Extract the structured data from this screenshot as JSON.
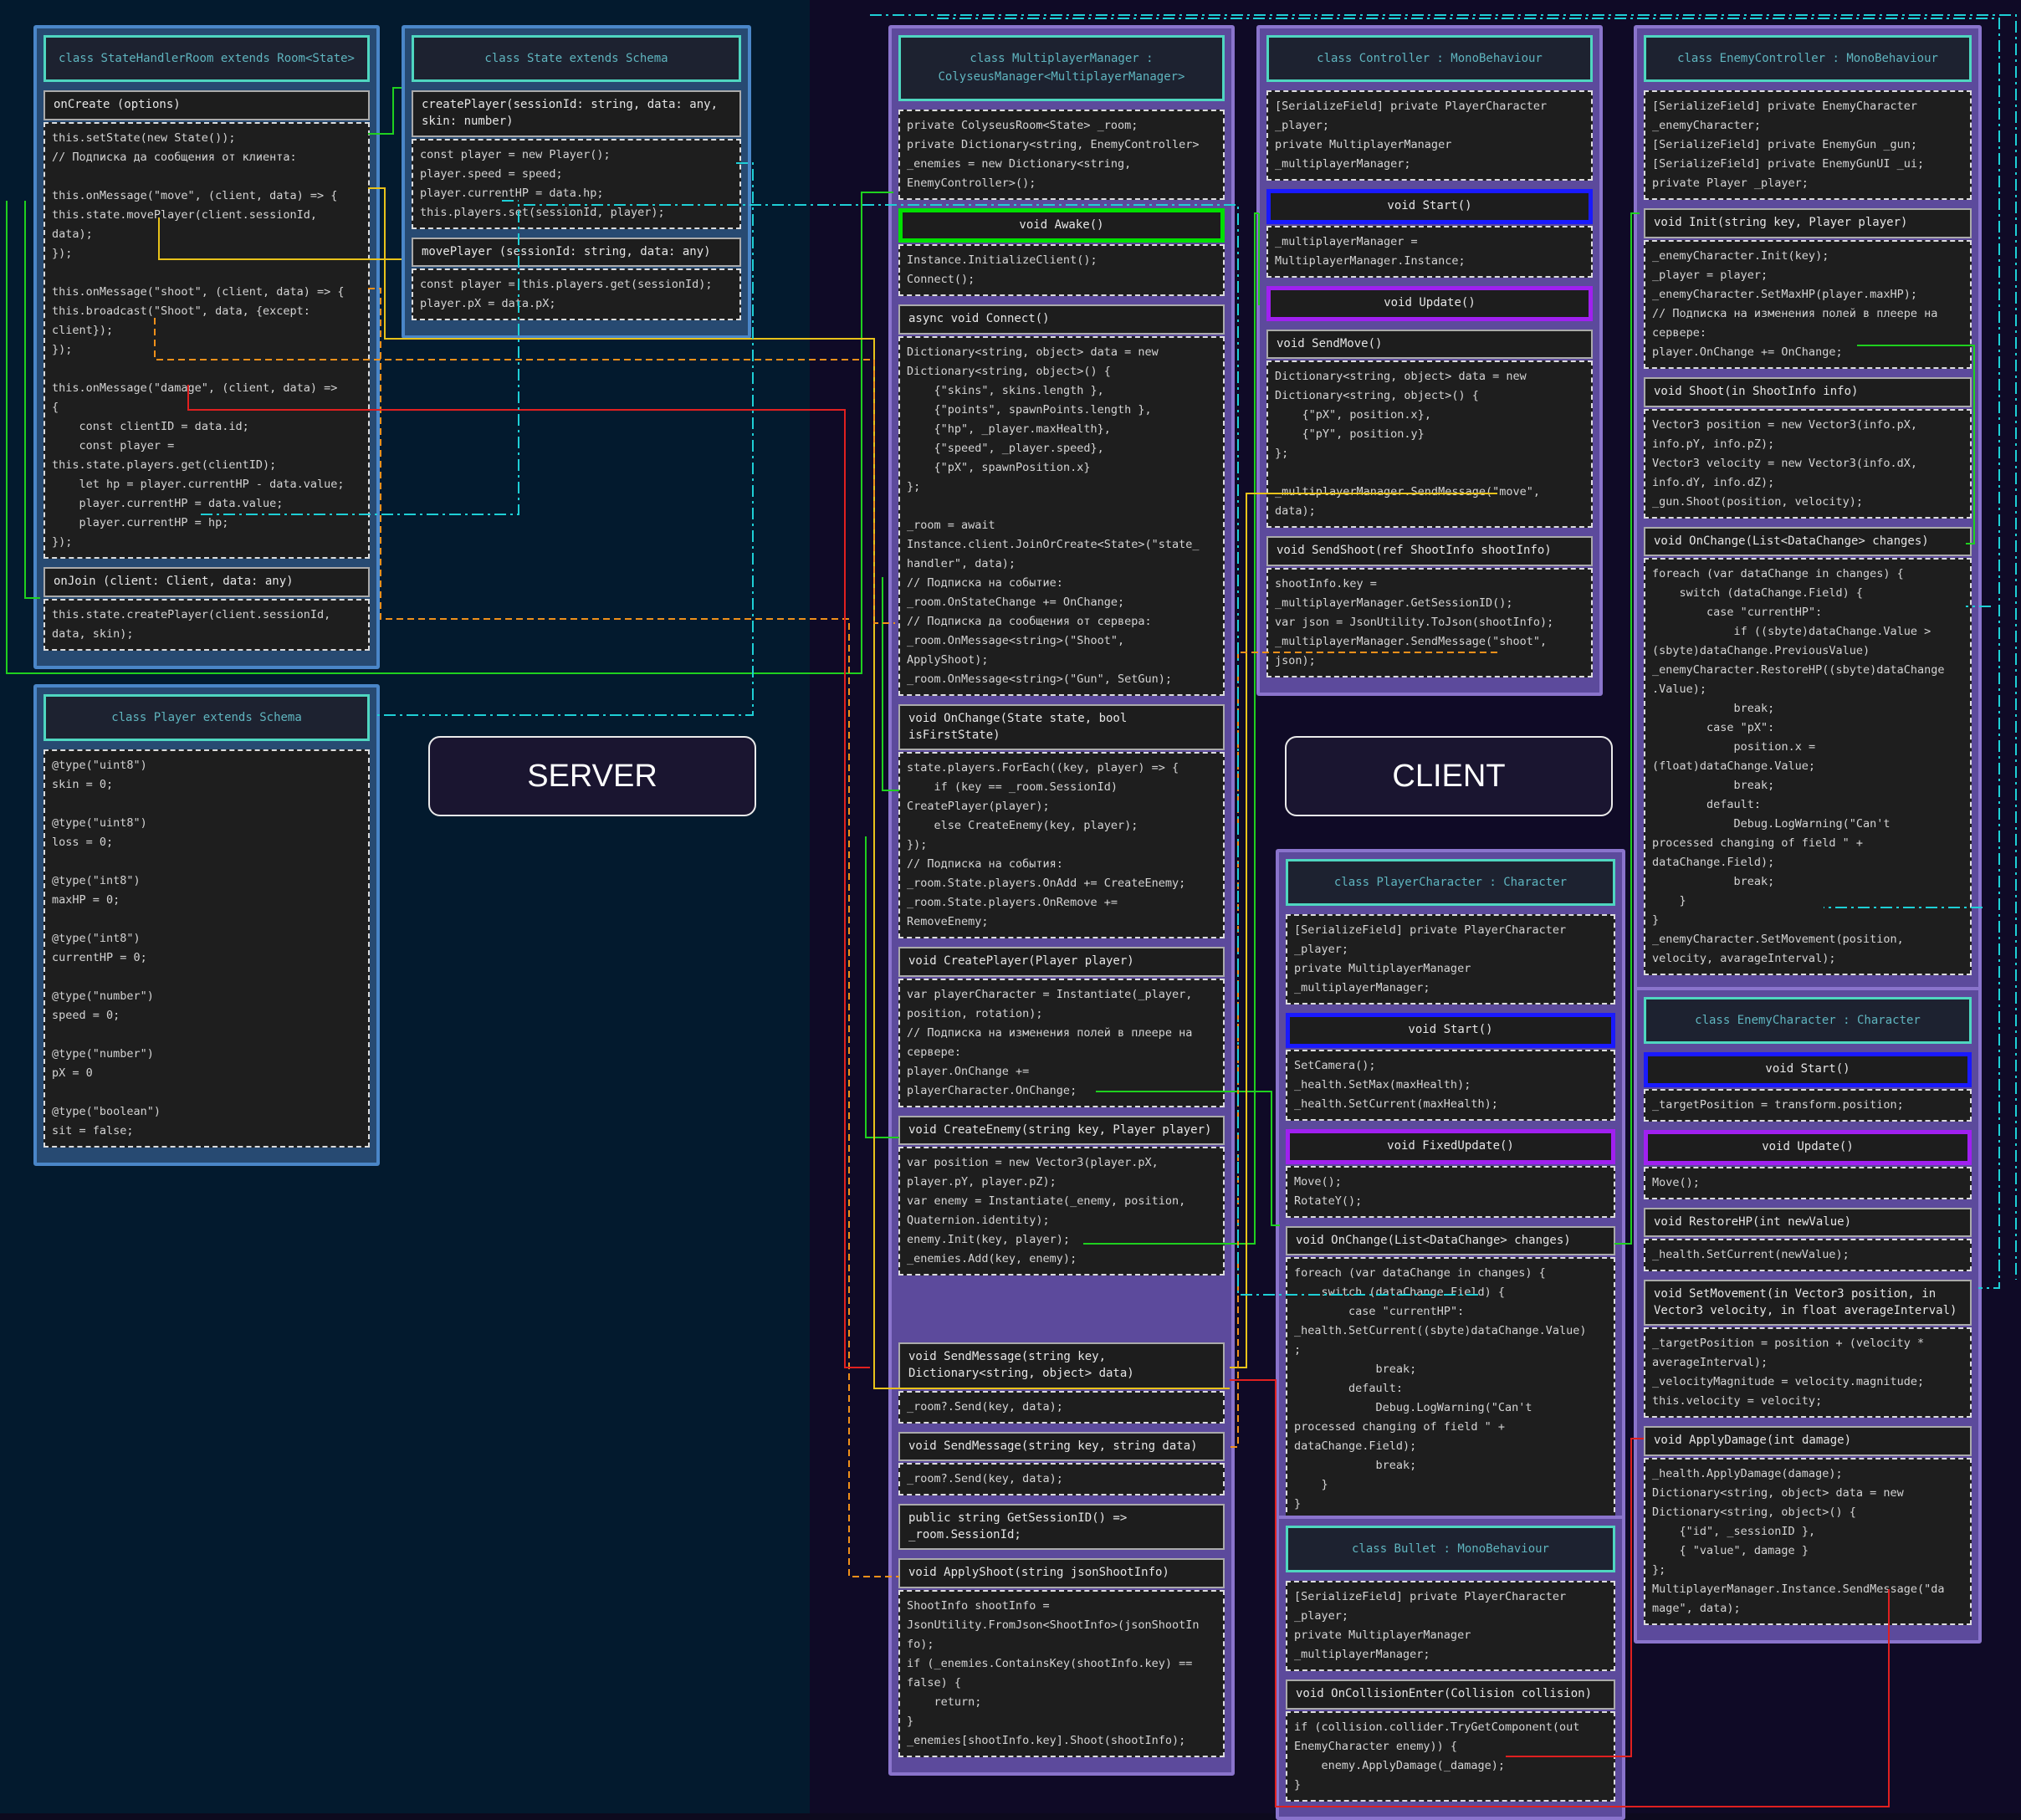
{
  "labels": {
    "server": "SERVER",
    "client": "CLIENT"
  },
  "colors": {
    "server_bg": "#031a2e",
    "client_bg": "#0f0a26",
    "class_head_border": "#4fd6c0",
    "awake_border": "#00e000",
    "start_border": "#1a1aff",
    "update_border": "#a020f0"
  },
  "classes": [
    {
      "id": "state-handler-room",
      "side": "srv",
      "title": "class StateHandlerRoom extends Room<State>",
      "sections": [
        {
          "h": "onCreate (options)",
          "b": "this.setState(new State());\n// Подписка да сообщения от клиента:\n\nthis.onMessage(\"move\", (client, data) => {\nthis.state.movePlayer(client.sessionId,\ndata);\n});\n\nthis.onMessage(\"shoot\", (client, data) => {\nthis.broadcast(\"Shoot\", data, {except:\nclient});\n});\n\nthis.onMessage(\"damage\", (client, data) =>\n{\n    const clientID = data.id;\n    const player =\nthis.state.players.get(clientID);\n    let hp = player.currentHP - data.value;\n    player.currentHP = data.value;\n    player.currentHP = hp;\n});"
        },
        {
          "h": "onJoin (client: Client, data: any)",
          "b": "this.state.createPlayer(client.sessionId,\ndata, skin);"
        }
      ]
    },
    {
      "id": "state-schema",
      "side": "srv",
      "title": "class State extends Schema",
      "sections": [
        {
          "h": "createPlayer(sessionId: string, data: any,\nskin: number)",
          "b": "const player = new Player();\nplayer.speed = speed;\nplayer.currentHP = data.hp;\nthis.players.set(sessionId, player);"
        },
        {
          "h": "movePlayer (sessionId: string, data: any)",
          "b": "const player = this.players.get(sessionId);\nplayer.pX = data.pX;"
        }
      ]
    },
    {
      "id": "player-schema",
      "side": "srv",
      "title": "class Player extends Schema",
      "sections": [
        {
          "b": "@type(\"uint8\")\nskin = 0;\n\n@type(\"uint8\")\nloss = 0;\n\n@type(\"int8\")\nmaxHP = 0;\n\n@type(\"int8\")\ncurrentHP = 0;\n\n@type(\"number\")\nspeed = 0;\n\n@type(\"number\")\npX = 0\n\n@type(\"boolean\")\nsit = false;"
        }
      ]
    },
    {
      "id": "multiplayer-manager",
      "side": "cli",
      "title": "class MultiplayerManager :\nColyseusManager<MultiplayerManager>",
      "sections": [
        {
          "b": "private ColyseusRoom<State> _room;\nprivate Dictionary<string, EnemyController>\n_enemies = new Dictionary<string,\nEnemyController>();"
        },
        {
          "h": "void Awake()",
          "k": "green",
          "b": "Instance.InitializeClient();\nConnect();"
        },
        {
          "h": "async void Connect()",
          "b": "Dictionary<string, object> data = new\nDictionary<string, object>() {\n    {\"skins\", skins.length },\n    {\"points\", spawnPoints.length },\n    {\"hp\", _player.maxHealth},\n    {\"speed\", _player.speed},\n    {\"pX\", spawnPosition.x}\n};\n\n_room = await\nInstance.client.JoinOrCreate<State>(\"state_\nhandler\", data);\n// Подписка на событие:\n_room.OnStateChange += OnChange;\n// Подписка да сообщения от сервера:\n_room.OnMessage<string>(\"Shoot\",\nApplyShoot);\n_room.OnMessage<string>(\"Gun\", SetGun);"
        },
        {
          "h": "void OnChange(State state, bool\nisFirstState)",
          "b": "state.players.ForEach((key, player) => {\n    if (key == _room.SessionId)\nCreatePlayer(player);\n    else CreateEnemy(key, player);\n});\n// Подписка на события:\n_room.State.players.OnAdd += CreateEnemy;\n_room.State.players.OnRemove +=\nRemoveEnemy;"
        },
        {
          "h": "void CreatePlayer(Player player)",
          "b": "var playerCharacter = Instantiate(_player,\nposition, rotation);\n// Подписка на изменения полей в плеере на\nсервере:\nplayer.OnChange +=\nplayerCharacter.OnChange;"
        },
        {
          "h": "void CreateEnemy(string key, Player player)",
          "b": "var position = new Vector3(player.pX,\nplayer.pY, player.pZ);\nvar enemy = Instantiate(_enemy, position,\nQuaternion.identity);\nenemy.Init(key, player);\n_enemies.Add(key, enemy);"
        },
        {
          "gap": 70
        },
        {
          "h": "void SendMessage(string key,\nDictionary<string, object> data)",
          "b": "_room?.Send(key, data);"
        },
        {
          "h": "void SendMessage(string key, string data)",
          "b": "_room?.Send(key, data);"
        },
        {
          "h": "public string GetSessionID() =>\n_room.SessionId;"
        },
        {
          "h": "void ApplyShoot(string jsonShootInfo)",
          "b": "ShootInfo shootInfo =\nJsonUtility.FromJson<ShootInfo>(jsonShootIn\nfo);\nif (_enemies.ContainsKey(shootInfo.key) ==\nfalse) {\n    return;\n}\n_enemies[shootInfo.key].Shoot(shootInfo);"
        }
      ]
    },
    {
      "id": "controller",
      "side": "cli",
      "title": "class Controller : MonoBehaviour",
      "sections": [
        {
          "b": "[SerializeField] private PlayerCharacter\n_player;\nprivate MultiplayerManager\n_multiplayerManager;"
        },
        {
          "h": "void Start()",
          "k": "blue",
          "b": "_multiplayerManager =\nMultiplayerManager.Instance;"
        },
        {
          "h": "void Update()",
          "k": "purple"
        },
        {
          "h": "void SendMove()",
          "b": "Dictionary<string, object> data = new\nDictionary<string, object>() {\n    {\"pX\", position.x},\n    {\"pY\", position.y}\n};\n\n_multiplayerManager.SendMessage(\"move\",\ndata);"
        },
        {
          "h": "void SendShoot(ref ShootInfo shootInfo)",
          "b": "shootInfo.key =\n_multiplayerManager.GetSessionID();\nvar json = JsonUtility.ToJson(shootInfo);\n_multiplayerManager.SendMessage(\"shoot\",\njson);"
        }
      ]
    },
    {
      "id": "player-character",
      "side": "cli",
      "title": "class PlayerCharacter : Character",
      "sections": [
        {
          "b": "[SerializeField] private PlayerCharacter\n_player;\nprivate MultiplayerManager\n_multiplayerManager;"
        },
        {
          "h": "void Start()",
          "k": "blue",
          "b": "SetCamera();\n_health.SetMax(maxHealth);\n_health.SetCurrent(maxHealth);"
        },
        {
          "h": "void FixedUpdate()",
          "k": "purple",
          "b": "Move();\nRotateY();"
        },
        {
          "h": "void OnChange(List<DataChange> changes)",
          "b": "foreach (var dataChange in changes) {\n    switch (dataChange.Field) {\n        case \"currentHP\":\n_health.SetCurrent((sbyte)dataChange.Value)\n;\n            break;\n        default:\n            Debug.LogWarning(\"Can't\nprocessed changing of field \" +\ndataChange.Field);\n            break;\n    }\n}"
        }
      ]
    },
    {
      "id": "bullet",
      "side": "cli",
      "title": "class Bullet : MonoBehaviour",
      "sections": [
        {
          "b": "[SerializeField] private PlayerCharacter\n_player;\nprivate MultiplayerManager\n_multiplayerManager;"
        },
        {
          "h": "void OnCollisionEnter(Collision collision)",
          "b": "if (collision.collider.TryGetComponent(out\nEnemyCharacter enemy)) {\n    enemy.ApplyDamage(_damage);\n}"
        }
      ]
    },
    {
      "id": "enemy-controller",
      "side": "cli",
      "title": "class EnemyController : MonoBehaviour",
      "sections": [
        {
          "b": "[SerializeField] private EnemyCharacter\n_enemyCharacter;\n[SerializeField] private EnemyGun _gun;\n[SerializeField] private EnemyGunUI _ui;\nprivate Player _player;"
        },
        {
          "h": "void Init(string key, Player player)",
          "b": "_enemyCharacter.Init(key);\n_player = player;\n_enemyCharacter.SetMaxHP(player.maxHP);\n// Подписка на изменения полей в плеере на\nсервере:\nplayer.OnChange += OnChange;"
        },
        {
          "h": "void Shoot(in ShootInfo info)",
          "b": "Vector3 position = new Vector3(info.pX,\ninfo.pY, info.pZ);\nVector3 velocity = new Vector3(info.dX,\ninfo.dY, info.dZ);\n_gun.Shoot(position, velocity);"
        },
        {
          "h": "void OnChange(List<DataChange> changes)",
          "b": "foreach (var dataChange in changes) {\n    switch (dataChange.Field) {\n        case \"currentHP\":\n            if ((sbyte)dataChange.Value >\n(sbyte)dataChange.PreviousValue)\n_enemyCharacter.RestoreHP((sbyte)dataChange\n.Value);\n            break;\n        case \"pX\":\n            position.x =\n(float)dataChange.Value;\n            break;\n        default:\n            Debug.LogWarning(\"Can't\nprocessed changing of field \" +\ndataChange.Field);\n            break;\n    }\n}\n_enemyCharacter.SetMovement(position,\nvelocity, avarageInterval);"
        }
      ]
    },
    {
      "id": "enemy-character",
      "side": "cli",
      "title": "class EnemyCharacter : Character",
      "sections": [
        {
          "h": "void Start()",
          "k": "blue",
          "b": "_targetPosition = transform.position;"
        },
        {
          "h": "void Update()",
          "k": "purple",
          "b": "Move();"
        },
        {
          "h": "void RestoreHP(int newValue)",
          "b": "_health.SetCurrent(newValue);"
        },
        {
          "h": "void SetMovement(in Vector3 position, in\nVector3 velocity, in float averageInterval)",
          "b": "_targetPosition = position + (velocity *\naverageInterval);\n_velocityMagnitude = velocity.magnitude;\nthis.velocity = velocity;"
        },
        {
          "h": "void ApplyDamage(int damage)",
          "b": "_health.ApplyDamage(damage);\nDictionary<string, object> data = new\nDictionary<string, object>() {\n    {\"id\", _sessionID },\n    { \"value\", damage }\n};\nMultiplayerManager.Instance.SendMessage(\"da\nmage\", data);"
        }
      ]
    }
  ]
}
